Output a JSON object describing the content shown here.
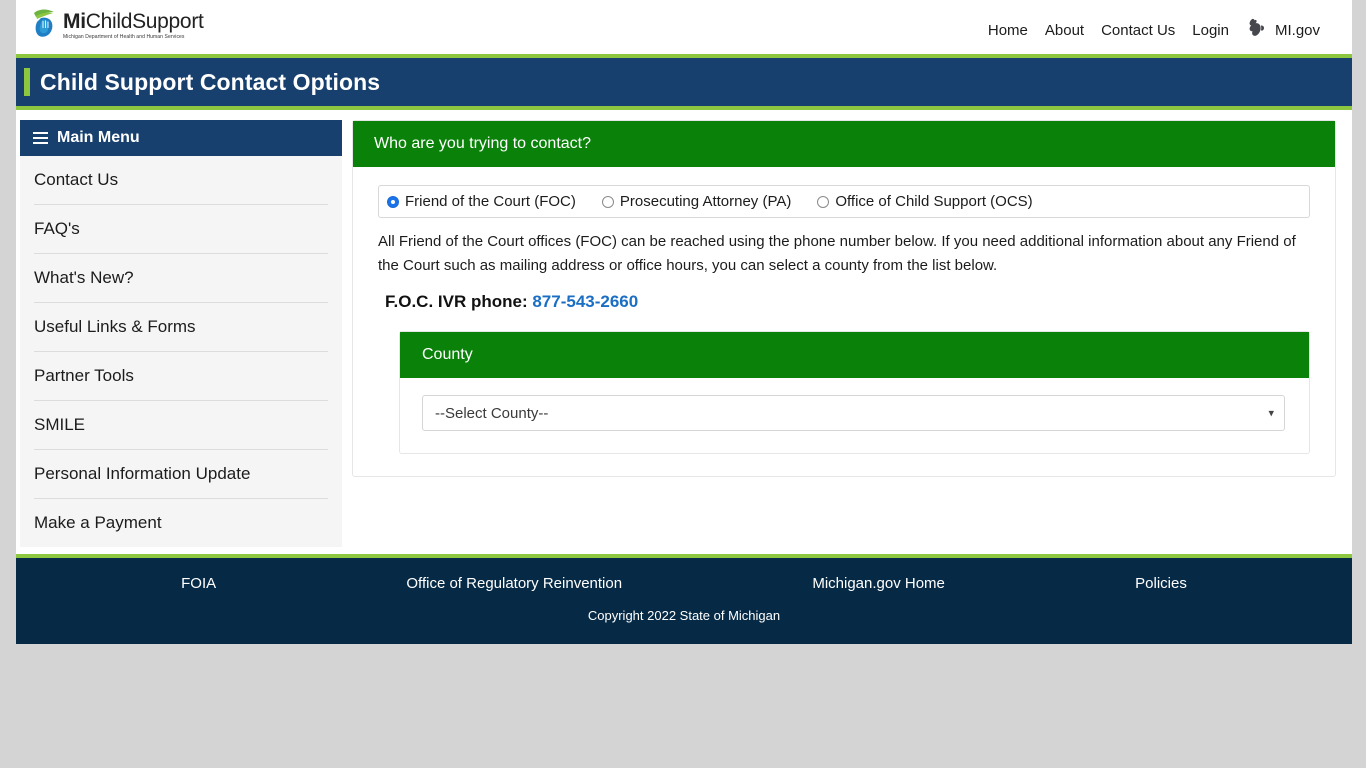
{
  "header": {
    "logo": {
      "icon": "hand-leaf-logo-icon",
      "brand_bold": "Mi",
      "brand_rest": "ChildSupport",
      "tagline": "Michigan Department of Health and Human Services"
    },
    "nav": [
      {
        "label": "Home",
        "name": "nav-home"
      },
      {
        "label": "About",
        "name": "nav-about"
      },
      {
        "label": "Contact Us",
        "name": "nav-contact-us"
      },
      {
        "label": "Login",
        "name": "nav-login"
      }
    ],
    "migov": {
      "label": "MI.gov",
      "icon": "michigan-state-icon"
    }
  },
  "banner": {
    "title": "Child Support Contact Options"
  },
  "sidebar": {
    "header": "Main Menu",
    "menu_icon": "hamburger-icon",
    "items": [
      {
        "label": "Contact Us"
      },
      {
        "label": "FAQ's"
      },
      {
        "label": "What's New?"
      },
      {
        "label": "Useful Links & Forms"
      },
      {
        "label": "Partner Tools"
      },
      {
        "label": "SMILE"
      },
      {
        "label": "Personal Information Update"
      },
      {
        "label": "Make a Payment"
      }
    ]
  },
  "main": {
    "panel_title": "Who are you trying to contact?",
    "radio_options": [
      {
        "label": "Friend of the Court (FOC)",
        "selected": true
      },
      {
        "label": "Prosecuting Attorney (PA)",
        "selected": false
      },
      {
        "label": "Office of Child Support (OCS)",
        "selected": false
      }
    ],
    "description": "All Friend of the Court offices (FOC) can be reached using the phone number below. If you need additional information about any Friend of the Court such as mailing address or office hours, you can select a county from the list below.",
    "ivr_label": "F.O.C. IVR phone:",
    "ivr_phone": "877-543-2660",
    "county": {
      "panel_title": "County",
      "select_value": "--Select County--",
      "caret_icon": "chevron-down-icon"
    }
  },
  "footer": {
    "links": [
      {
        "label": "FOIA"
      },
      {
        "label": "Office of Regulatory Reinvention"
      },
      {
        "label": "Michigan.gov Home"
      },
      {
        "label": "Policies"
      }
    ],
    "copyright": "Copyright  2022 State of Michigan"
  },
  "colors": {
    "navy": "#17406e",
    "footer_navy": "#062a45",
    "green": "#0a820a",
    "accent_green": "#8dc63f",
    "link_blue": "#1a6ec4"
  }
}
